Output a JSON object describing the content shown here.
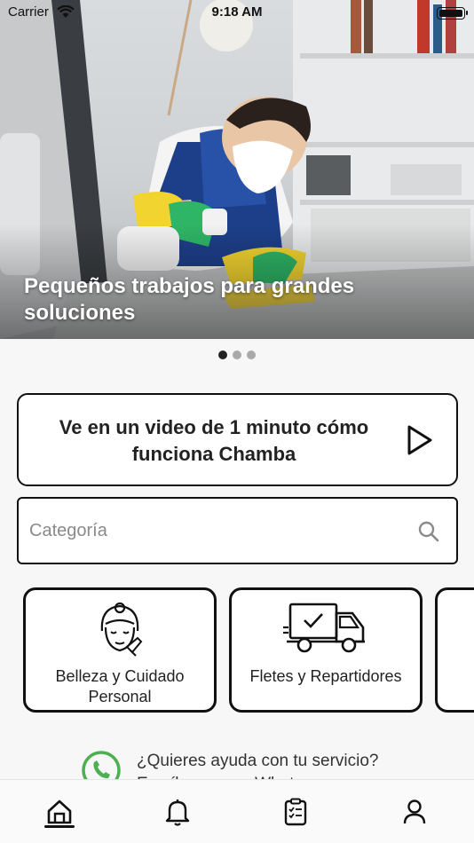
{
  "status": {
    "carrier": "Carrier",
    "time": "9:18 AM"
  },
  "hero": {
    "caption": "Pequeños trabajos para grandes soluciones",
    "slides": 3,
    "active_slide": 1
  },
  "video_card": {
    "text": "Ve en un video de 1 minuto cómo funciona Chamba",
    "icon": "play-icon"
  },
  "search": {
    "placeholder": "Categoría",
    "value": "",
    "icon": "search-icon"
  },
  "categories": [
    {
      "label": "Belleza y Cuidado Personal",
      "icon": "beauty-icon"
    },
    {
      "label": "Fletes y Repartidores",
      "icon": "delivery-truck-icon"
    },
    {
      "label": "",
      "icon": ""
    }
  ],
  "help": {
    "line1": "¿Quieres ayuda con tu servicio?",
    "line2": "Escríbenos por Whatsapp",
    "icon": "whatsapp-icon",
    "whatsapp_color": "#4CAF50"
  },
  "tabs": [
    {
      "name": "home",
      "icon": "home-icon",
      "active": true
    },
    {
      "name": "notifications",
      "icon": "bell-icon",
      "active": false
    },
    {
      "name": "orders",
      "icon": "clipboard-checklist-icon",
      "active": false
    },
    {
      "name": "profile",
      "icon": "user-icon",
      "active": false
    }
  ]
}
